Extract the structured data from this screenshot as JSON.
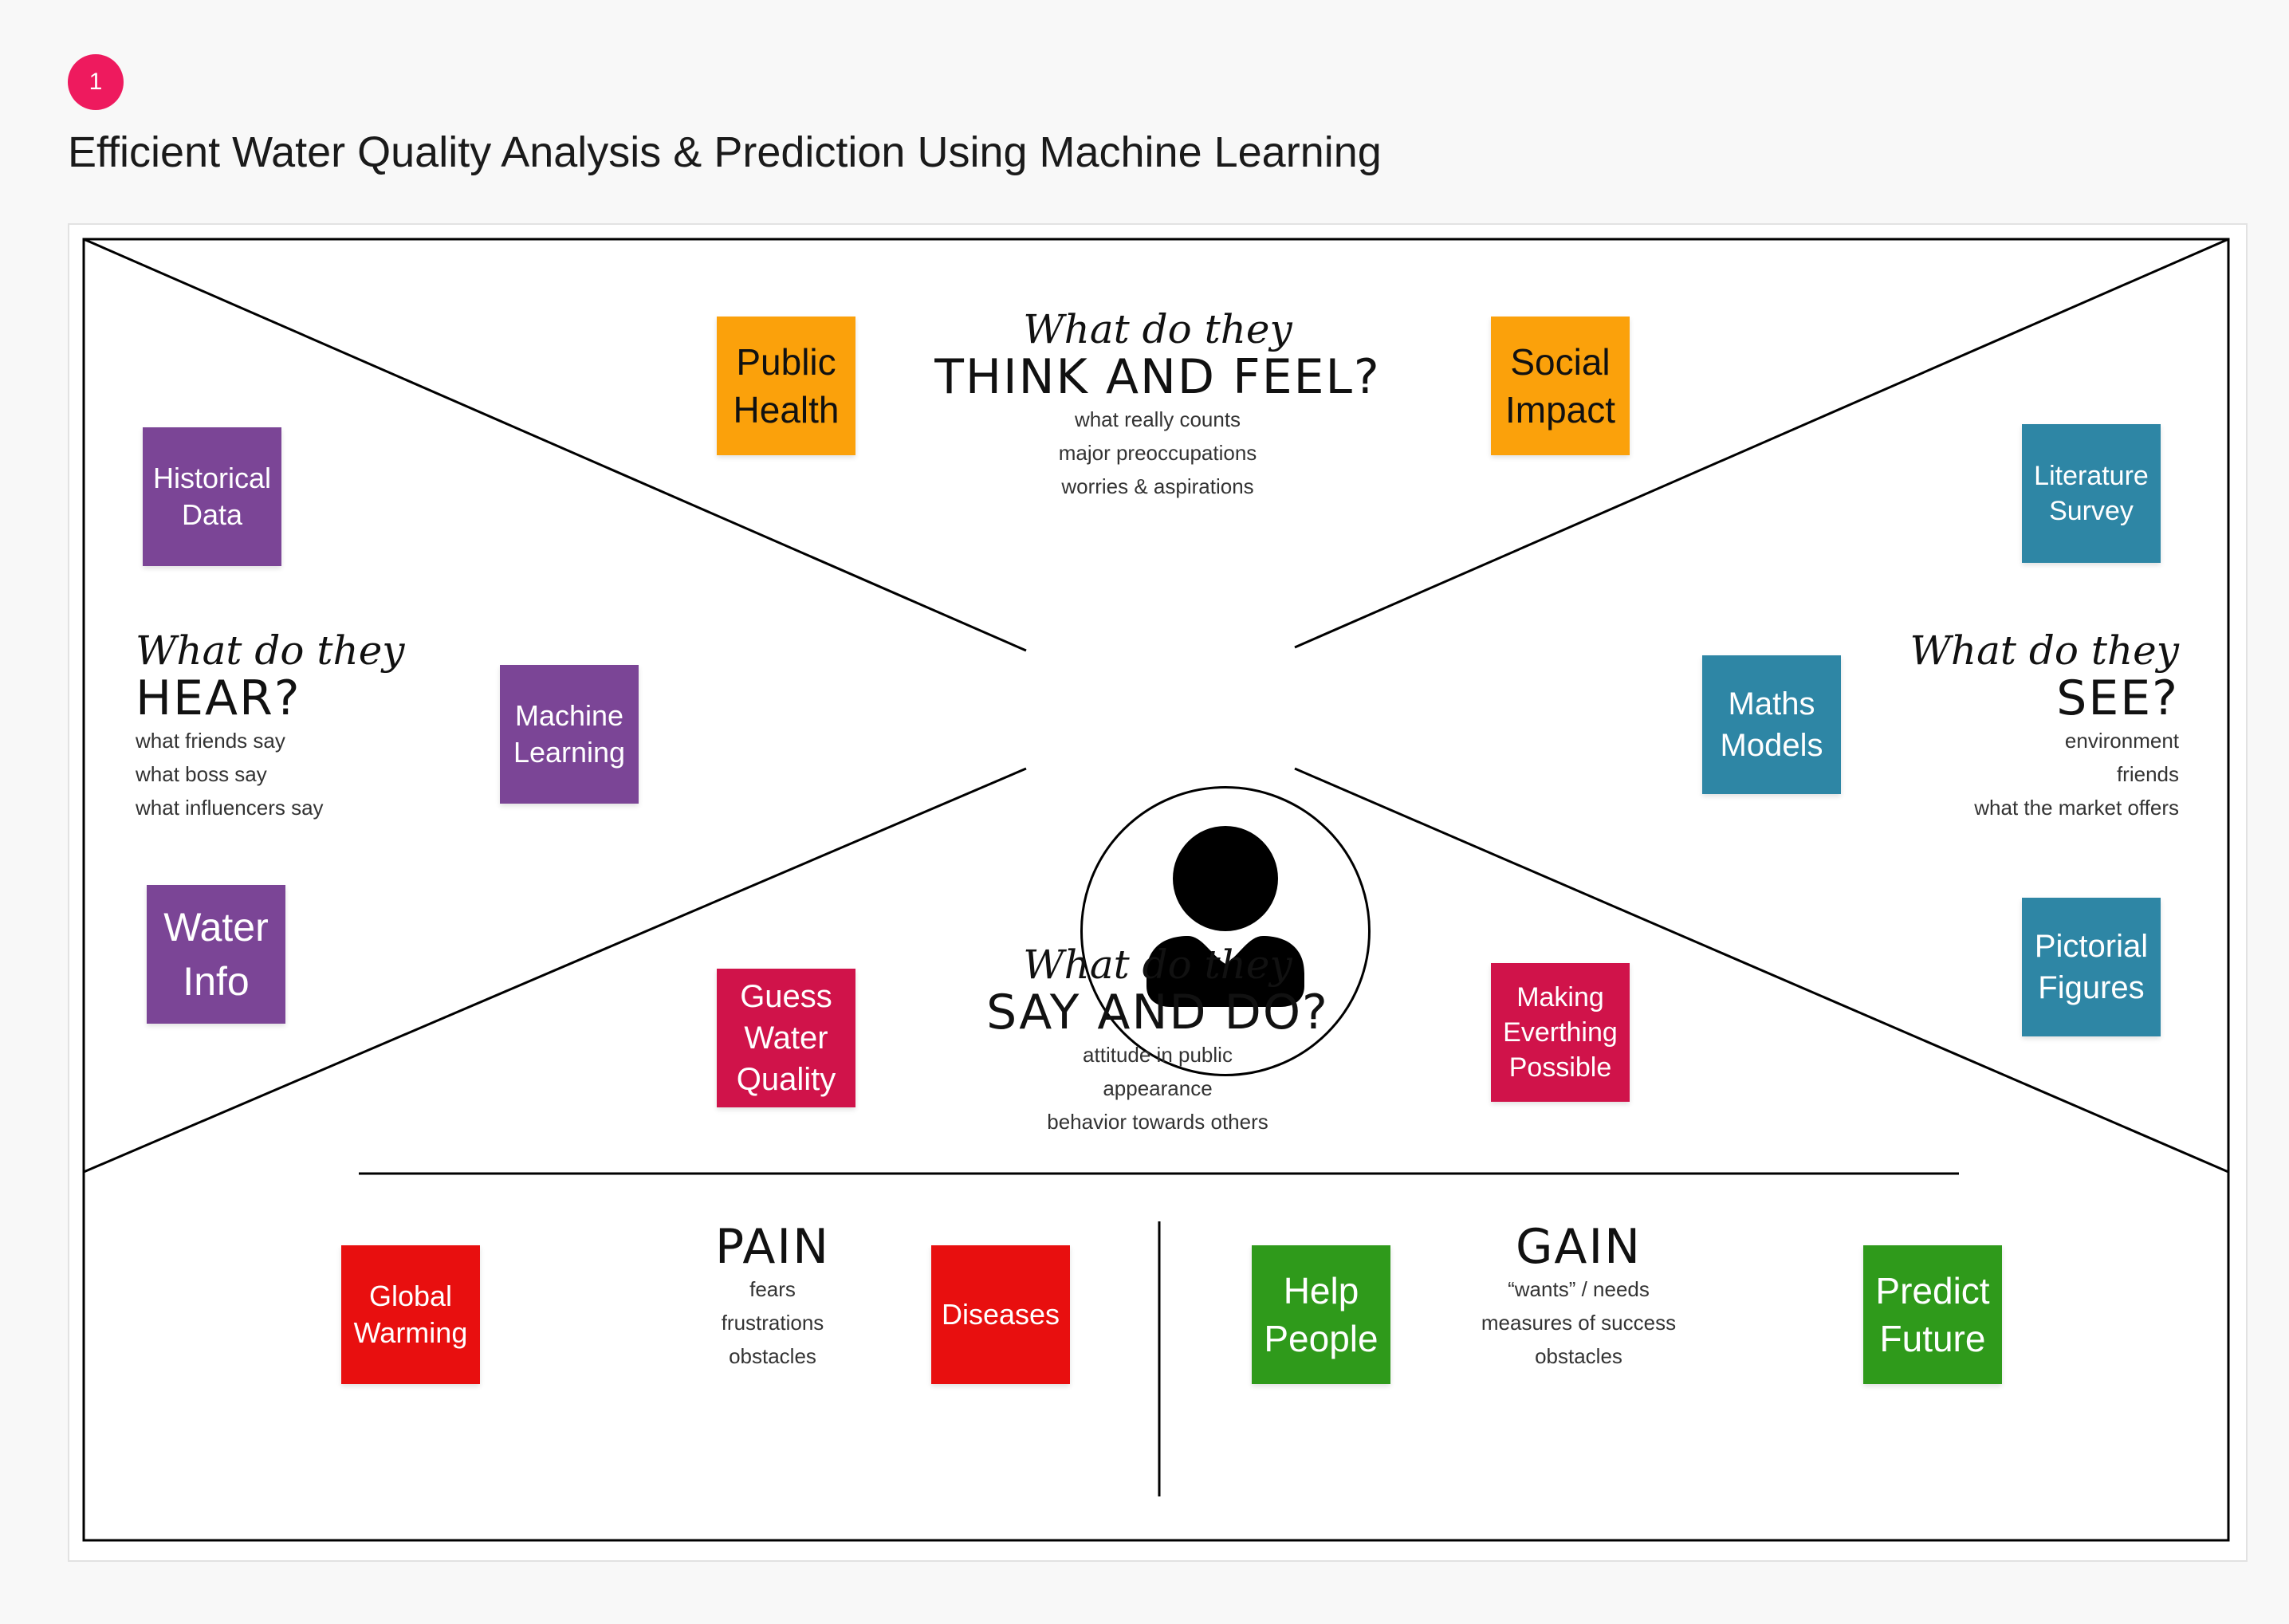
{
  "step_number": "1",
  "title": "Efficient Water Quality Analysis & Prediction Using Machine Learning",
  "sections": {
    "think_feel": {
      "prompt": "What do they",
      "heading": "THINK AND FEEL?",
      "lines": [
        "what really counts",
        "major preoccupations",
        "worries & aspirations"
      ]
    },
    "hear": {
      "prompt": "What do they",
      "heading": "HEAR?",
      "lines": [
        "what friends say",
        "what boss say",
        "what influencers say"
      ]
    },
    "see": {
      "prompt": "What do they",
      "heading": "SEE?",
      "lines": [
        "environment",
        "friends",
        "what the market offers"
      ]
    },
    "say_do": {
      "prompt": "What do they",
      "heading": "SAY AND DO?",
      "lines": [
        "attitude in public",
        "appearance",
        "behavior towards others"
      ]
    },
    "pain": {
      "heading": "PAIN",
      "lines": [
        "fears",
        "frustrations",
        "obstacles"
      ]
    },
    "gain": {
      "heading": "GAIN",
      "lines": [
        "“wants” / needs",
        "measures of success",
        "obstacles"
      ]
    }
  },
  "stickies": {
    "public_health": {
      "lines": [
        "Public",
        "Health"
      ],
      "color": "#fba10b"
    },
    "social_impact": {
      "lines": [
        "Social",
        "Impact"
      ],
      "color": "#fba10b"
    },
    "historical_data": {
      "lines": [
        "Historical",
        "Data"
      ],
      "color": "#7b4596"
    },
    "machine_learning": {
      "lines": [
        "Machine",
        "Learning"
      ],
      "color": "#7b4596"
    },
    "water_info": {
      "lines": [
        "Water",
        "Info"
      ],
      "color": "#7b4596"
    },
    "literature_survey": {
      "lines": [
        "Literature",
        "Survey"
      ],
      "color": "#2e86a5"
    },
    "maths_models": {
      "lines": [
        "Maths",
        "Models"
      ],
      "color": "#2e86a5"
    },
    "pictorial_figures": {
      "lines": [
        "Pictorial",
        "Figures"
      ],
      "color": "#2e86a5"
    },
    "guess_water_quality": {
      "lines": [
        "Guess",
        "Water",
        "Quality"
      ],
      "color": "#d0134a"
    },
    "making_everything_possible": {
      "lines": [
        "Making",
        "Everthing",
        "Possible"
      ],
      "color": "#d0134a"
    },
    "global_warming": {
      "lines": [
        "Global",
        "Warming"
      ],
      "color": "#e80f0f"
    },
    "diseases": {
      "lines": [
        "Diseases"
      ],
      "color": "#e80f0f"
    },
    "help_people": {
      "lines": [
        "Help",
        "People"
      ],
      "color": "#2f9a1b"
    },
    "predict_future": {
      "lines": [
        "Predict",
        "Future"
      ],
      "color": "#2f9a1b"
    }
  },
  "center_icon": "person-icon"
}
